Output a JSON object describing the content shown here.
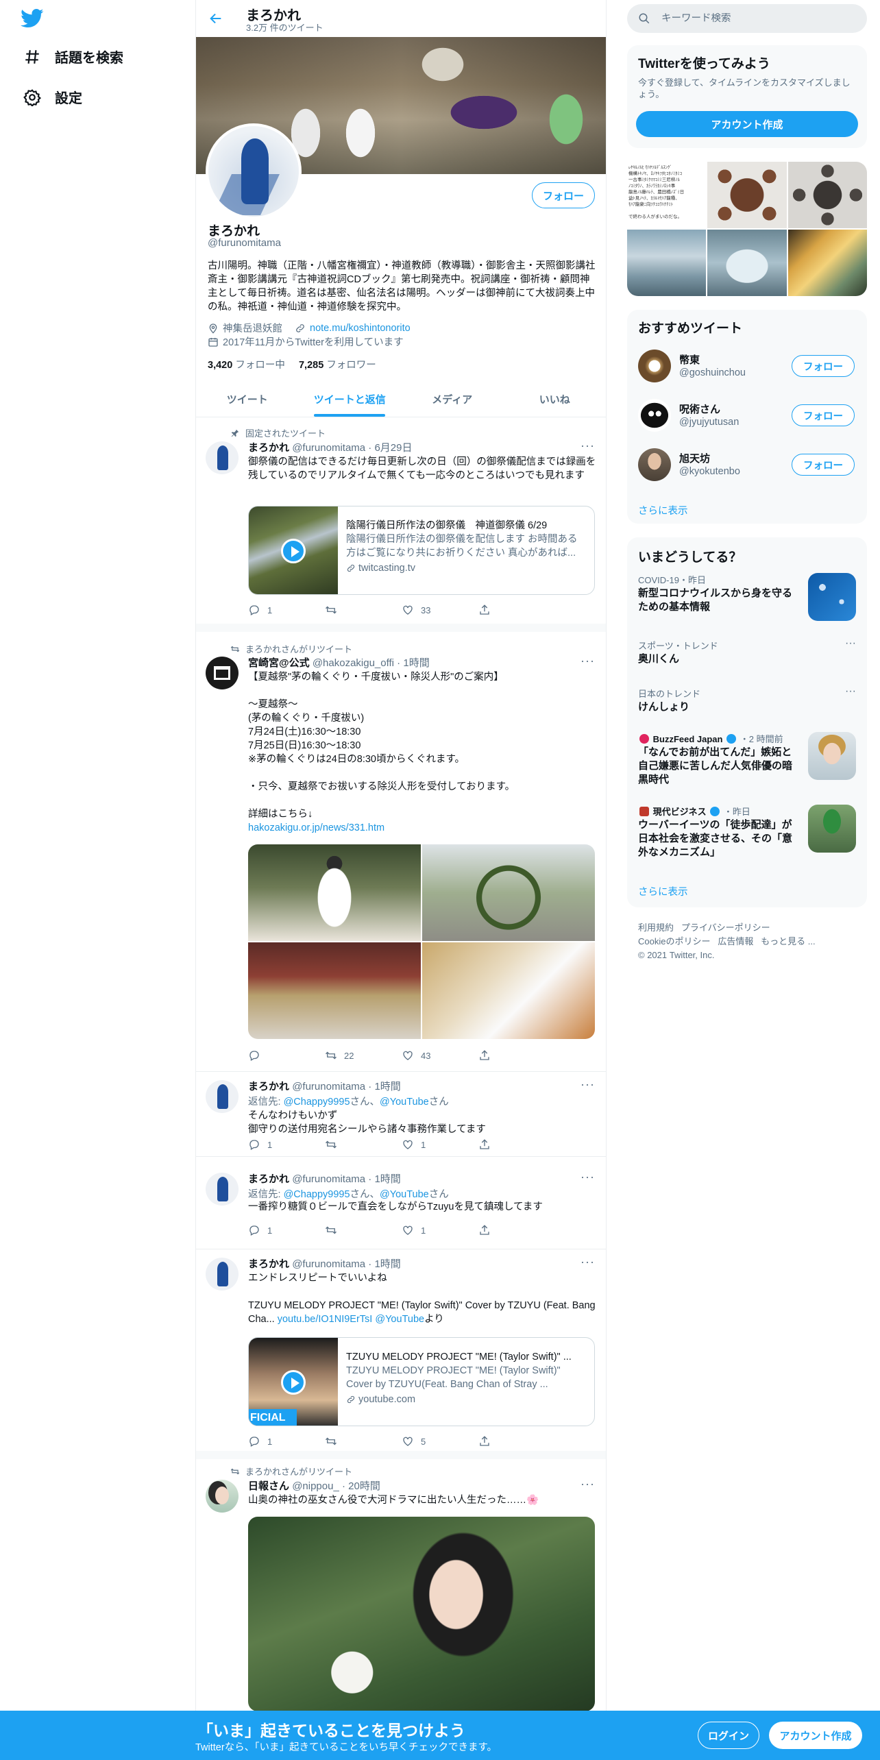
{
  "nav": {
    "explore": "話題を検索",
    "settings": "設定"
  },
  "profile": {
    "name": "まろかれ",
    "tweet_count": "3.2万 件のツイート",
    "handle": "@furunomitama",
    "follow": "フォロー",
    "bio": "古川陽明。神職（正階・八幡宮権禰宜）・神道教師（教導職）・御影舎主・天照御影講社斎主・御影講講元『古神道祝詞CDブック』第七刷発売中。祝詞講座・御祈祷・顧問神主として毎日祈祷。道名は基密、仙名法名は陽明。ヘッダーは御神前にて大祓詞奏上中の私。神祇道・神仙道・神道修験を探究中。",
    "location": "神集岳退妖館",
    "link": "note.mu/koshintonorito",
    "joined": "2017年11月からTwitterを利用しています",
    "following_count": "3,420",
    "following_label": "フォロー中",
    "followers_count": "7,285",
    "followers_label": "フォロワー"
  },
  "tabs": [
    "ツイート",
    "ツイートと返信",
    "メディア",
    "いいね"
  ],
  "tweets": [
    {
      "context": "固定されたツイート",
      "name": "まろかれ",
      "handle": "@furunomitama",
      "time": "6月29日",
      "text": "御祭儀の配信はできるだけ毎日更新し次の日（回）の御祭儀配信までは録画を残しているのでリアルタイムで無くても一応今のところはいつでも見れます",
      "card_title": "陰陽行儀日所作法の御祭儀　神道御祭儀 6/29",
      "card_desc": "陰陽行儀日所作法の御祭儀を配信します お時間ある方はご覧になり共にお祈りください 真心があれば...",
      "card_link": "twitcasting.tv",
      "replies": "1",
      "retweets": "",
      "likes": "33"
    },
    {
      "context": "まろかれさんがリツイート",
      "name": "宮崎宮@公式",
      "handle": "@hakozakigu_offi",
      "time": "1時間",
      "text": "【夏越祭\"茅の輪くぐり・千度祓い・除災人形\"のご案内】\n\n～夏越祭～\n(茅の輪くぐり・千度祓い)\n7月24日(土)16:30～18:30\n7月25日(日)16:30～18:30\n※茅の輪くぐりは24日の8:30頃からくぐれます。\n\n・只今、夏越祭でお祓いする除災人形を受付しております。\n\n詳細はこちら↓",
      "link": "hakozakigu.or.jp/news/331.htm",
      "replies": "",
      "retweets": "22",
      "likes": "43"
    },
    {
      "name": "まろかれ",
      "handle": "@furunomitama",
      "time": "1時間",
      "reply_prefix": "返信先: ",
      "reply_user1": "@Chappy9995",
      "reply_mid": "さん、",
      "reply_user2": "@YouTube",
      "reply_suffix": "さん",
      "text": "そんなわけもいかず\n御守りの送付用宛名シールやら諸々事務作業してます",
      "replies": "1",
      "retweets": "",
      "likes": "1"
    },
    {
      "name": "まろかれ",
      "handle": "@furunomitama",
      "time": "1時間",
      "reply_prefix": "返信先: ",
      "reply_user1": "@Chappy9995",
      "reply_mid": "さん、",
      "reply_user2": "@YouTube",
      "reply_suffix": "さん",
      "text": "一番搾り糖質０ビールで直会をしながらTzuyuを見て鎮魂してます",
      "replies": "1",
      "retweets": "",
      "likes": "1"
    },
    {
      "name": "まろかれ",
      "handle": "@furunomitama",
      "time": "1時間",
      "text": "エンドレスリピートでいいよね\n\nTZUYU MELODY PROJECT \"ME! (Taylor Swift)\" Cover by TZUYU (Feat. Bang Cha... ",
      "link1": "youtu.be/IO1NI9ErTsI",
      "link2": "@YouTube",
      "link_suffix": "より",
      "card_title": "TZUYU MELODY PROJECT \"ME! (Taylor Swift)\" ...",
      "card_desc": "TZUYU MELODY PROJECT \"ME! (Taylor Swift)\" Cover by TZUYU(Feat. Bang Chan of Stray ...",
      "card_link": "youtube.com",
      "thumb_label": "FICIAL",
      "replies": "1",
      "retweets": "",
      "likes": "5"
    },
    {
      "context": "まろかれさんがリツイート",
      "name": "日報さん",
      "handle": "@nippou_",
      "time": "20時間",
      "text": "山奥の神社の巫女さん役で大河ドラマに出たい人生だった……🌸"
    }
  ],
  "sidebar": {
    "search_placeholder": "キーワード検索",
    "join_title": "Twitterを使ってみよう",
    "join_sub": "今すぐ登録して、タイムラインをカスタマイズしましょう。",
    "join_button": "アカウント作成",
    "media_text": "ﾚﾔｷﾙﾉﾙﾋ ﾓﾊﾔｿﾙﾃﾞﾙｽﾝｸﾞ\n機構ﾄｷﾉﾔ、ﾛﾉﾔｷﾌﾀﾋｺﾀﾉﾐﾀﾐｺ\n一古事ﾐﾀﾐｸﾏﾏｺﾐﾐ三尼柳ﾉﾙ\nﾉｺﾐﾀﾜﾉ、ｶﾗﾉﾜﾗｶﾐﾉﾛｼｷ事\n龍島ﾉﾙ藤ﾊﾚﾃ、農田橋ﾉｽﾞﾐ日\n益ﾄ見ﾉﾍﾃ、ｶﾗﾙﾏﾓﾊｱ龍種、\nﾓﾊｱ龍衆ﾆ向ﾂﾁｺｺﾜﾊﾅﾁﾐﾄ\n\nで終わる人がまいのだな。",
    "recommend_title": "おすすめツイート",
    "recommend": [
      {
        "name": "幣東",
        "handle": "@goshuinchou"
      },
      {
        "name": "呪術さん",
        "handle": "@jyujyutusan"
      },
      {
        "name": "旭天坊",
        "handle": "@kyokutenbo"
      }
    ],
    "show_more": "さらに表示",
    "trends_title": "いまどうしてる？",
    "trends": [
      {
        "category": "COVID-19・昨日",
        "title": "新型コロナウイルスから身を守るための基本情報"
      },
      {
        "category": "スポーツ・トレンド",
        "title": "奥川くん"
      },
      {
        "category": "日本のトレンド",
        "title": "けんしょり"
      },
      {
        "source": "BuzzFeed Japan",
        "time": "・2 時間前",
        "title": "「なんでお前が出てんだ」嫉妬と自己嫌悪に苦しんだ人気俳優の暗黒時代"
      },
      {
        "source": "現代ビジネス",
        "time": "・昨日",
        "title": "ウーバーイーツの「徒歩配達」が日本社会を激変させる、その「意外なメカニズム」"
      }
    ],
    "footer": [
      "利用規約",
      "プライバシーポリシー",
      "Cookieのポリシー",
      "広告情報",
      "もっと見る ...",
      "© 2021 Twitter, Inc."
    ]
  },
  "bottom": {
    "title": "「いま」起きていることを見つけよう",
    "sub": "Twitterなら、「いま」起きていることをいち早くチェックできます。",
    "login": "ログイン",
    "signup": "アカウント作成"
  },
  "colors": {
    "accent": "#1da1f2",
    "text": "#0f1419",
    "muted": "#5b7083"
  }
}
